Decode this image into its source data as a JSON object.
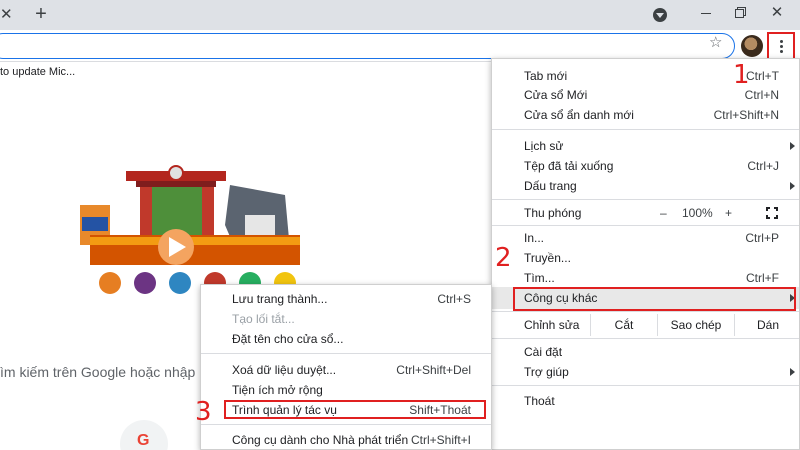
{
  "bookmarks": {
    "item": "to update Mic..."
  },
  "page": {
    "search_hint": "ìm kiếm trên Google hoặc nhập"
  },
  "main_menu": {
    "new_tab": {
      "label": "Tab mới",
      "shortcut": "Ctrl+T"
    },
    "new_window": {
      "label": "Cửa sổ Mới",
      "shortcut": "Ctrl+N"
    },
    "incognito": {
      "label": "Cửa sổ ẩn danh mới",
      "shortcut": "Ctrl+Shift+N"
    },
    "history": {
      "label": "Lịch sử"
    },
    "downloads": {
      "label": "Tệp đã tải xuống",
      "shortcut": "Ctrl+J"
    },
    "bookmarks": {
      "label": "Dấu trang"
    },
    "zoom": {
      "label": "Thu phóng",
      "minus": "–",
      "value": "100%",
      "plus": "+"
    },
    "print": {
      "label": "In...",
      "shortcut": "Ctrl+P"
    },
    "cast": {
      "label": "Truyền..."
    },
    "find": {
      "label": "Tìm...",
      "shortcut": "Ctrl+F"
    },
    "more_tools": {
      "label": "Công cụ khác"
    },
    "edit": {
      "label": "Chỉnh sửa",
      "cut": "Cắt",
      "copy": "Sao chép",
      "paste": "Dán"
    },
    "settings": {
      "label": "Cài đặt"
    },
    "help": {
      "label": "Trợ giúp"
    },
    "exit": {
      "label": "Thoát"
    }
  },
  "sub_menu": {
    "save_page": {
      "label": "Lưu trang thành...",
      "shortcut": "Ctrl+S"
    },
    "create_shortcut": {
      "label": "Tạo lối tắt..."
    },
    "name_window": {
      "label": "Đặt tên cho cửa sổ..."
    },
    "clear_data": {
      "label": "Xoá dữ liệu duyệt...",
      "shortcut": "Ctrl+Shift+Del"
    },
    "extensions": {
      "label": "Tiện ích mở rộng"
    },
    "task_manager": {
      "label": "Trình quản lý tác vụ",
      "shortcut": "Shift+Thoát"
    },
    "dev_tools": {
      "label": "Công cụ dành cho Nhà phát triển",
      "shortcut": "Ctrl+Shift+I"
    }
  },
  "steps": {
    "one": "1",
    "two": "2",
    "three": "3"
  },
  "colors": {
    "highlight": "#e02020",
    "accent": "#1a73e8",
    "tabstrip": "#dee1e6"
  },
  "icons": [
    "close-icon",
    "plus-icon",
    "profile-dropdown-icon",
    "minimize-icon",
    "maximize-icon",
    "window-close-icon",
    "star-icon",
    "avatar",
    "more-vert-icon",
    "fullscreen-icon",
    "chevron-right-icon"
  ]
}
